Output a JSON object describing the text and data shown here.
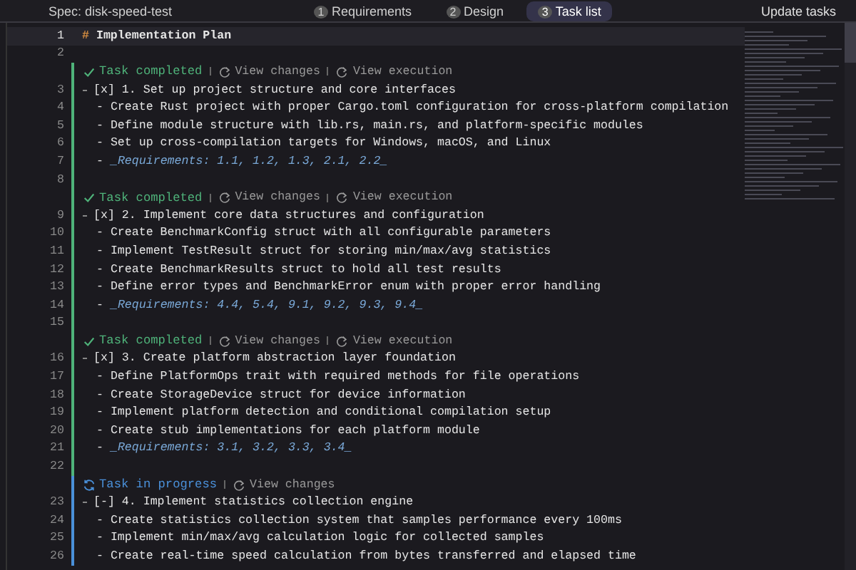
{
  "header": {
    "title": "Spec: disk-speed-test",
    "tabs": [
      {
        "number": "1",
        "label": "Requirements",
        "selected": false
      },
      {
        "number": "2",
        "label": "Design",
        "selected": false
      },
      {
        "number": "3",
        "label": "Task list",
        "selected": true
      }
    ],
    "update_button": "Update tasks"
  },
  "editor": {
    "rows": [
      {
        "kind": "heading",
        "number": "1",
        "current": true,
        "marker": "#",
        "text": "Implementation Plan"
      },
      {
        "kind": "blank",
        "number": "2",
        "current": false
      },
      {
        "kind": "lens",
        "completed": true,
        "label": "Task completed",
        "actions": [
          "View changes",
          "View execution"
        ]
      },
      {
        "kind": "task",
        "number": "3",
        "current": false,
        "text": "[x] 1. Set up project structure and core interfaces"
      },
      {
        "kind": "bullet",
        "number": "4",
        "current": false,
        "text": "- Create Rust project with proper Cargo.toml configuration for cross-platform compilation"
      },
      {
        "kind": "bullet",
        "number": "5",
        "current": false,
        "text": "- Define module structure with lib.rs, main.rs, and platform-specific modules"
      },
      {
        "kind": "bullet",
        "number": "6",
        "current": false,
        "text": "- Set up cross-compilation targets for Windows, macOS, and Linux"
      },
      {
        "kind": "bullet",
        "number": "7",
        "current": false,
        "text": "- *_Requirements: 1.1, 1.2, 1.3, 2.1, 2.2_*"
      },
      {
        "kind": "blank",
        "number": "8",
        "current": false
      },
      {
        "kind": "lens",
        "completed": true,
        "label": "Task completed",
        "actions": [
          "View changes",
          "View execution"
        ]
      },
      {
        "kind": "task",
        "number": "9",
        "current": false,
        "text": "[x] 2. Implement core data structures and configuration"
      },
      {
        "kind": "bullet",
        "number": "10",
        "current": false,
        "text": "- Create BenchmarkConfig struct with all configurable parameters"
      },
      {
        "kind": "bullet",
        "number": "11",
        "current": false,
        "text": "- Implement TestResult struct for storing min/max/avg statistics"
      },
      {
        "kind": "bullet",
        "number": "12",
        "current": false,
        "text": "- Create BenchmarkResults struct to hold all test results"
      },
      {
        "kind": "bullet",
        "number": "13",
        "current": false,
        "text": "- Define error types and BenchmarkError enum with proper error handling"
      },
      {
        "kind": "bullet",
        "number": "14",
        "current": false,
        "text": "- *_Requirements: 4.4, 5.4, 9.1, 9.2, 9.3, 9.4_*"
      },
      {
        "kind": "blank",
        "number": "15",
        "current": false
      },
      {
        "kind": "lens",
        "completed": true,
        "label": "Task completed",
        "actions": [
          "View changes",
          "View execution"
        ]
      },
      {
        "kind": "task",
        "number": "16",
        "current": false,
        "text": "[x] 3. Create platform abstraction layer foundation"
      },
      {
        "kind": "bullet",
        "number": "17",
        "current": false,
        "text": "- Define PlatformOps trait with required methods for file operations"
      },
      {
        "kind": "bullet",
        "number": "18",
        "current": false,
        "text": "- Create StorageDevice struct for device information"
      },
      {
        "kind": "bullet",
        "number": "19",
        "current": false,
        "text": "- Implement platform detection and conditional compilation setup"
      },
      {
        "kind": "bullet",
        "number": "20",
        "current": false,
        "text": "- Create stub implementations for each platform module"
      },
      {
        "kind": "bullet",
        "number": "21",
        "current": false,
        "text": "- *_Requirements: 3.1, 3.2, 3.3, 3.4_*"
      },
      {
        "kind": "blank",
        "number": "22",
        "current": false
      },
      {
        "kind": "lens",
        "completed": false,
        "label": "Task in progress",
        "actions": [
          "View changes"
        ]
      },
      {
        "kind": "task",
        "number": "23",
        "current": false,
        "text": "[-] 4. Implement statistics collection engine"
      },
      {
        "kind": "bullet",
        "number": "24",
        "current": false,
        "text": "- Create statistics collection system that samples performance every 100ms"
      },
      {
        "kind": "bullet",
        "number": "25",
        "current": false,
        "text": "- Implement min/max/avg calculation logic for collected samples"
      },
      {
        "kind": "bullet",
        "number": "26",
        "current": false,
        "text": "- Create real-time speed calculation from bytes transferred and elapsed time"
      }
    ]
  }
}
